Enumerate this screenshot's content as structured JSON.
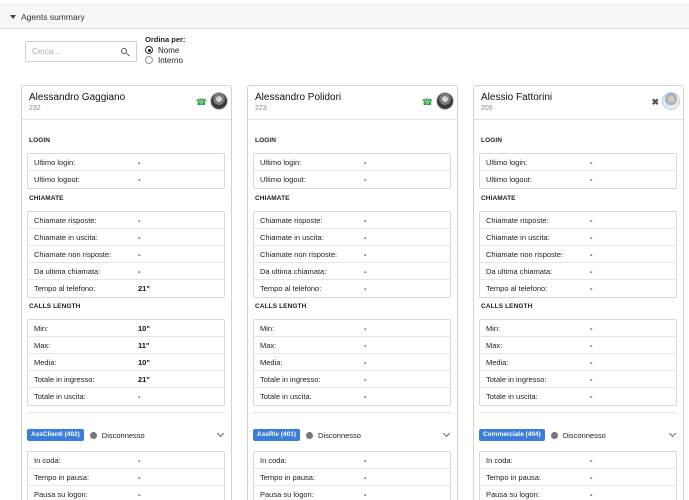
{
  "panel": {
    "title": "Agents summary"
  },
  "search": {
    "placeholder": "Cerca..."
  },
  "sort": {
    "title": "Ordina per:",
    "options": [
      "Nome",
      "Interno"
    ],
    "selected": "Nome"
  },
  "labels": {
    "login": "LOGIN",
    "chiamate": "CHIAMATE",
    "calls_length": "CALLS LENGTH",
    "ultimo_login": "Ultimo login:",
    "ultimo_logout": "Ultimo logout:",
    "chiamate_risposte": "Chiamate risposte:",
    "chiamate_uscita": "Chiamate in uscita:",
    "chiamate_non_risposte": "Chiamate non risposte:",
    "da_ultima": "Da ultima chiamata:",
    "tempo_telefono": "Tempo al telefono:",
    "min": "Min:",
    "max": "Max:",
    "media": "Media:",
    "totale_ingresso": "Totale in ingresso:",
    "totale_uscita": "Totale in uscita:",
    "in_coda": "In coda:",
    "tempo_pausa": "Tempo in pausa:",
    "pausa_logon": "Pausa su logon:"
  },
  "agents": [
    {
      "name": "Alessandro Gaggiano",
      "ext": "232",
      "status_icon": "phone-icon",
      "login": [
        "-",
        "-"
      ],
      "chiamate": [
        "-",
        "-",
        "-",
        "-",
        "21\""
      ],
      "calls_length": [
        "10\"",
        "11\"",
        "10\"",
        "21\"",
        "-"
      ],
      "queue": "AssClienti (402)",
      "queue_status": "Disconnesso",
      "queue_stats": [
        "-",
        "-",
        "-"
      ]
    },
    {
      "name": "Alessandro Polidori",
      "ext": "223",
      "status_icon": "phone-icon",
      "login": [
        "-",
        "-"
      ],
      "chiamate": [
        "-",
        "-",
        "-",
        "-",
        "-"
      ],
      "calls_length": [
        "-",
        "-",
        "-",
        "-",
        "-"
      ],
      "queue": "AssRiv (401)",
      "queue_status": "Disconnesso",
      "queue_stats": [
        "-",
        "-",
        "-"
      ]
    },
    {
      "name": "Alessio Fattorini",
      "ext": "205",
      "status_icon": "close-icon",
      "login": [
        "-",
        "-"
      ],
      "chiamate": [
        "-",
        "-",
        "-",
        "-",
        "-"
      ],
      "calls_length": [
        "-",
        "-",
        "-",
        "-",
        "-"
      ],
      "queue": "Commerciale (404)",
      "queue_status": "Disconnesso",
      "queue_stats": [
        "-",
        "-",
        "-"
      ]
    }
  ],
  "icons": {
    "phone": "☎",
    "close": "✖"
  },
  "colors": {
    "badge": "#3b7ddb",
    "phone": "#2e9e3e"
  }
}
